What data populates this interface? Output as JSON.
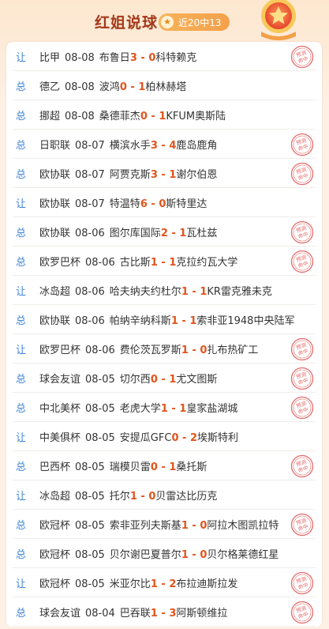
{
  "header": {
    "title": "红姐说球",
    "record": "近20中13",
    "star_icon": "star-icon",
    "medal_icon": "medal-star-icon"
  },
  "stamp_text": [
    "预测",
    "命中"
  ],
  "colors": {
    "accent": "#e2541c",
    "type": "#3f86d6",
    "title": "#a2391a",
    "stamp": "#e56a6a"
  },
  "rows": [
    {
      "type": "让",
      "league": "比甲",
      "date": "08-08",
      "home": "布鲁日",
      "hs": "3",
      "sep": " - ",
      "as": "0",
      "away": "科特赖克",
      "hit": true
    },
    {
      "type": "总",
      "league": "德乙",
      "date": "08-08",
      "home": "波鸿",
      "hs": "0",
      "sep": " - ",
      "as": "1",
      "away": "柏林赫塔",
      "hit": false
    },
    {
      "type": "总",
      "league": "挪超",
      "date": "08-08",
      "home": "桑德菲杰",
      "hs": "0",
      "sep": " - ",
      "as": "1",
      "away": "KFUM奥斯陆",
      "hit": false
    },
    {
      "type": "总",
      "league": "日职联",
      "date": "08-07",
      "home": "横滨水手",
      "hs": "3",
      "sep": " - ",
      "as": "4",
      "away": "鹿岛鹿角",
      "hit": true
    },
    {
      "type": "总",
      "league": "欧协联",
      "date": "08-07",
      "home": "阿贾克斯",
      "hs": "3",
      "sep": " - ",
      "as": "1",
      "away": "谢尔伯恩",
      "hit": true
    },
    {
      "type": "让",
      "league": "欧协联",
      "date": "08-07",
      "home": "特温特",
      "hs": "6",
      "sep": " - ",
      "as": "0",
      "away": "斯特里达",
      "hit": false
    },
    {
      "type": "总",
      "league": "欧协联",
      "date": "08-06",
      "home": "图尔库国际",
      "hs": "2",
      "sep": " - ",
      "as": "1",
      "away": "瓦杜兹",
      "hit": true
    },
    {
      "type": "总",
      "league": "欧罗巴杯",
      "date": "08-06",
      "home": "古比斯",
      "hs": "1",
      "sep": " - ",
      "as": "1",
      "away": "克拉约瓦大学",
      "hit": true
    },
    {
      "type": "让",
      "league": "冰岛超",
      "date": "08-06",
      "home": "哈夫纳夫约杜尔",
      "hs": "1",
      "sep": " - ",
      "as": "1",
      "away": "KR雷克雅未克",
      "hit": false
    },
    {
      "type": "总",
      "league": "欧协联",
      "date": "08-06",
      "home": "帕纳辛纳科斯",
      "hs": "1",
      "sep": " - ",
      "as": "1",
      "away": "索非亚1948中央陆军",
      "hit": false
    },
    {
      "type": "让",
      "league": "欧罗巴杯",
      "date": "08-06",
      "home": "费伦茨瓦罗斯",
      "hs": "1",
      "sep": " - ",
      "as": "0",
      "away": "扎布热矿工",
      "hit": true
    },
    {
      "type": "总",
      "league": "球会友谊",
      "date": "08-05",
      "home": "切尔西",
      "hs": "0",
      "sep": " - ",
      "as": "1",
      "away": "尤文图斯",
      "hit": true
    },
    {
      "type": "总",
      "league": "中北美杯",
      "date": "08-05",
      "home": "老虎大学",
      "hs": "1",
      "sep": " - ",
      "as": "1",
      "away": "皇家盐湖城",
      "hit": true
    },
    {
      "type": "让",
      "league": "中美俱杯",
      "date": "08-05",
      "home": "安提瓜GFC",
      "hs": "0",
      "sep": " - ",
      "as": "2",
      "away": "埃斯特利",
      "hit": false
    },
    {
      "type": "总",
      "league": "巴西杯",
      "date": "08-05",
      "home": "瑞模贝雷",
      "hs": "0",
      "sep": " - ",
      "as": "1",
      "away": "桑托斯",
      "hit": true
    },
    {
      "type": "让",
      "league": "冰岛超",
      "date": "08-05",
      "home": "托尔",
      "hs": "1",
      "sep": " - ",
      "as": "0",
      "away": "贝雷达比历克",
      "hit": false
    },
    {
      "type": "总",
      "league": "欧冠杯",
      "date": "08-05",
      "home": "索非亚列夫斯基",
      "hs": "1",
      "sep": " - ",
      "as": "0",
      "away": "阿拉木图凯拉特",
      "hit": true
    },
    {
      "type": "总",
      "league": "欧冠杯",
      "date": "08-05",
      "home": "贝尔谢巴夏普尔",
      "hs": "1",
      "sep": " - ",
      "as": "0",
      "away": "贝尔格莱德红星",
      "hit": false
    },
    {
      "type": "让",
      "league": "欧冠杯",
      "date": "08-05",
      "home": "米亚尔比",
      "hs": "1",
      "sep": " - ",
      "as": "2",
      "away": "布拉迪斯拉发",
      "hit": true
    },
    {
      "type": "总",
      "league": "球会友谊",
      "date": "08-04",
      "home": "巴吞联",
      "hs": "1",
      "sep": " - ",
      "as": "3",
      "away": "阿斯顿维拉",
      "hit": true
    }
  ]
}
